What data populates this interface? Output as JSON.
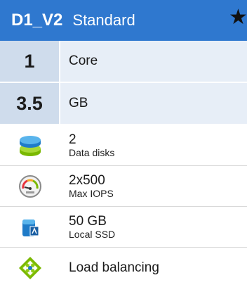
{
  "header": {
    "tier": "D1_V2",
    "plan": "Standard",
    "star_icon": "star-icon"
  },
  "specs": [
    {
      "value": "1",
      "label": "Core"
    },
    {
      "value": "3.5",
      "label": "GB"
    }
  ],
  "features": {
    "data_disks": {
      "value": "2",
      "label": "Data disks",
      "icon": "disk-stack-icon"
    },
    "iops": {
      "value": "2x500",
      "label": "Max IOPS",
      "icon": "gauge-icon"
    },
    "ssd": {
      "value": "50 GB",
      "label": "Local SSD",
      "icon": "ssd-icon"
    },
    "lb": {
      "label": "Load balancing",
      "icon": "load-balancer-icon"
    }
  },
  "colors": {
    "header_bg": "#2f78cf",
    "spec_value_bg": "#cfdcec",
    "spec_label_bg": "#e7eef7"
  }
}
